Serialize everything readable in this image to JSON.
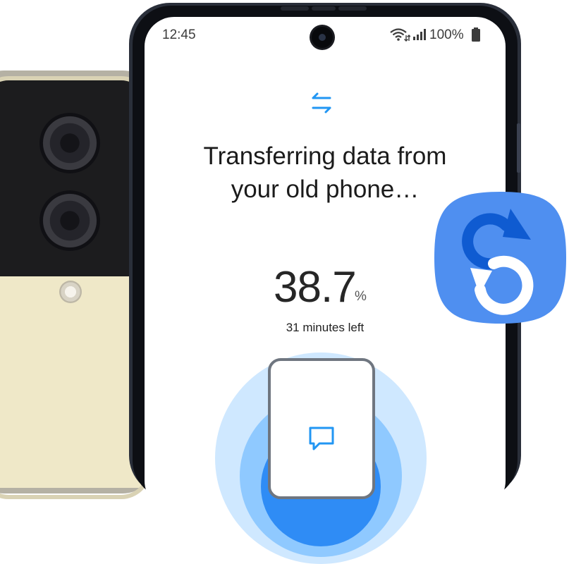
{
  "status_bar": {
    "time": "12:45",
    "battery": "100%",
    "icons": [
      "wifi-icon",
      "signal-icon",
      "battery-icon"
    ]
  },
  "transfer": {
    "icon": "transfer-arrows-icon",
    "title": "Transferring data from\nyour old phone…",
    "progress_value": "38.7",
    "progress_unit": "%",
    "progress_fraction": 0.387,
    "time_left": "31 minutes left"
  },
  "inner_phone": {
    "icon": "message-icon"
  },
  "app_icon": {
    "name": "smart-switch-app-icon"
  },
  "colors": {
    "accent": "#2196f3",
    "app_icon_bg": "#4f8ff0",
    "app_icon_arc": "#0f5bd1",
    "wave_outer": "#cfe8ff",
    "wave_mid": "#8fc9ff",
    "wave_inner": "#2f8cf5"
  }
}
